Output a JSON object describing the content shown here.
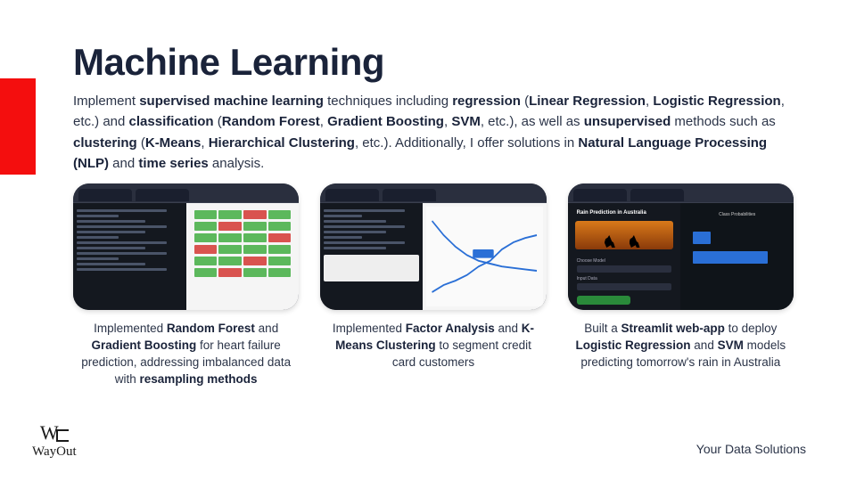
{
  "title": "Machine Learning",
  "subtitle": "Implement <strong>supervised machine learning</strong> techniques including <strong>regression</strong> (<strong>Linear Regression</strong>, <strong>Logistic Regression</strong>, etc.) and <strong>classification</strong> (<strong>Random Forest</strong>, <strong>Gradient Boosting</strong>, <strong>SVM</strong>, etc.), as well as <strong>unsupervised</strong> methods such as <strong>clustering</strong> (<strong>K-Means</strong>, <strong>Hierarchical Clustering</strong>, etc.). Additionally, I offer solutions in <strong>Natural Language Processing (NLP)</strong> and <strong>time series</strong> analysis.",
  "cards": [
    {
      "caption": "Implemented <strong>Random Forest</strong> and <strong>Gradient Boosting</strong> for heart failure prediction, addressing imbalanced data with <strong>resampling methods</strong>"
    },
    {
      "caption": "Implemented <strong>Factor Analysis</strong> and <strong>K-Means Clustering</strong> to segment credit card customers"
    },
    {
      "caption": "Built a <strong>Streamlit web-app</strong> to deploy <strong>Logistic Regression</strong> and <strong>SVM</strong> models predicting tomorrow's rain in Australia"
    }
  ],
  "thumb3": {
    "title": "Rain Prediction in Australia",
    "section1": "Choose Model",
    "section2": "Input Data",
    "probTitle": "Class Probabilities"
  },
  "logo": {
    "mark": "W",
    "text": "WayOut"
  },
  "footer": "Your Data Solutions"
}
